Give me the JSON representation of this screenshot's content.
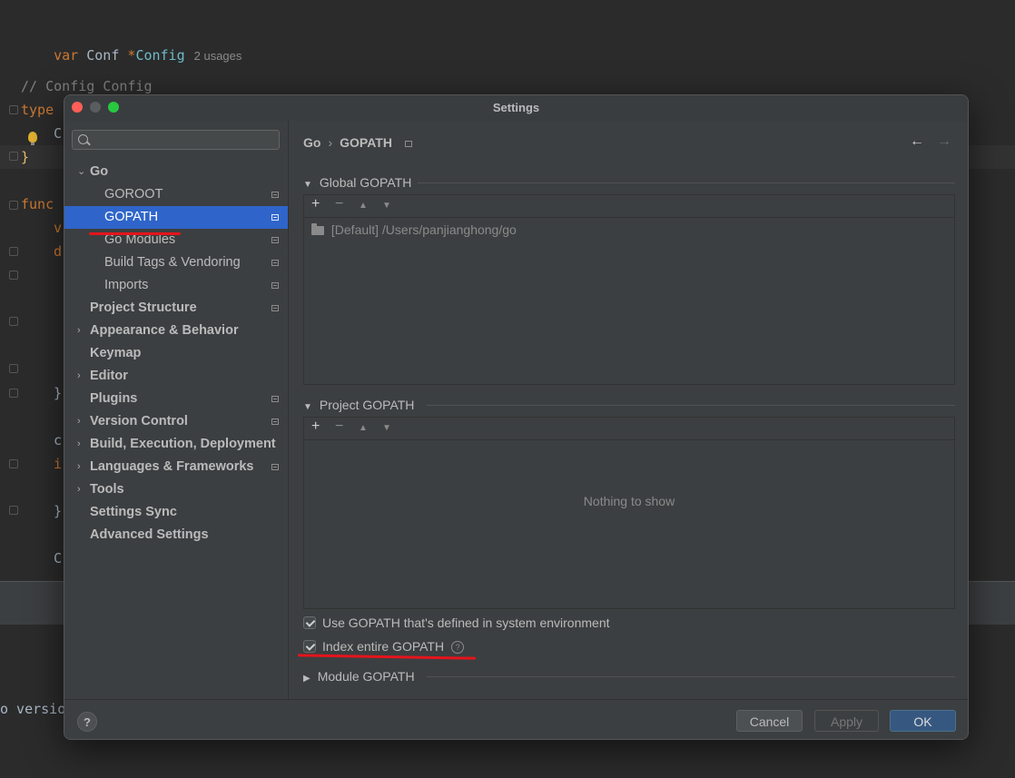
{
  "editor": {
    "line1_kw": "var",
    "line1_name": "Conf",
    "line1_star": "*",
    "line1_type": "Config",
    "line1_hint": "2 usages",
    "line2": "// Config Config",
    "line3": "type",
    "line4": "C",
    "line5": "}",
    "line6": "func",
    "line7": "v",
    "line8": "d",
    "line9": "}",
    "line10": "c",
    "line11": "i",
    "line12": "}",
    "line13": "C",
    "terminal_text": "o versio"
  },
  "dialog": {
    "title": "Settings"
  },
  "sidebar": {
    "search_placeholder": "",
    "items": [
      {
        "label": "Go"
      },
      {
        "label": "GOROOT"
      },
      {
        "label": "GOPATH"
      },
      {
        "label": "Go Modules"
      },
      {
        "label": "Build Tags & Vendoring"
      },
      {
        "label": "Imports"
      },
      {
        "label": "Project Structure"
      },
      {
        "label": "Appearance & Behavior"
      },
      {
        "label": "Keymap"
      },
      {
        "label": "Editor"
      },
      {
        "label": "Plugins"
      },
      {
        "label": "Version Control"
      },
      {
        "label": "Build, Execution, Deployment"
      },
      {
        "label": "Languages & Frameworks"
      },
      {
        "label": "Tools"
      },
      {
        "label": "Settings Sync"
      },
      {
        "label": "Advanced Settings"
      }
    ]
  },
  "content": {
    "breadcrumb": {
      "parent": "Go",
      "sep": "›",
      "current": "GOPATH"
    },
    "nav": {
      "back": "←",
      "forward": "→"
    },
    "global": {
      "header": "Global GOPATH",
      "entry_default": "[Default]",
      "entry_path": "/Users/panjianghong/go"
    },
    "project": {
      "header": "Project GOPATH",
      "empty_text": "Nothing to show"
    },
    "toolbar": {
      "add": "+",
      "remove": "−",
      "up": "▲",
      "down": "▼"
    },
    "use_env_label": "Use GOPATH that's defined in system environment",
    "use_env_checked": true,
    "index_label": "Index entire GOPATH",
    "index_checked": true,
    "help_glyph": "?",
    "module": {
      "header": "Module GOPATH"
    }
  },
  "footer": {
    "help": "?",
    "cancel": "Cancel",
    "apply": "Apply",
    "ok": "OK"
  },
  "colors": {
    "selection": "#2f65ca",
    "annotation_red": "#e5141c",
    "ok_button": "#365880"
  }
}
